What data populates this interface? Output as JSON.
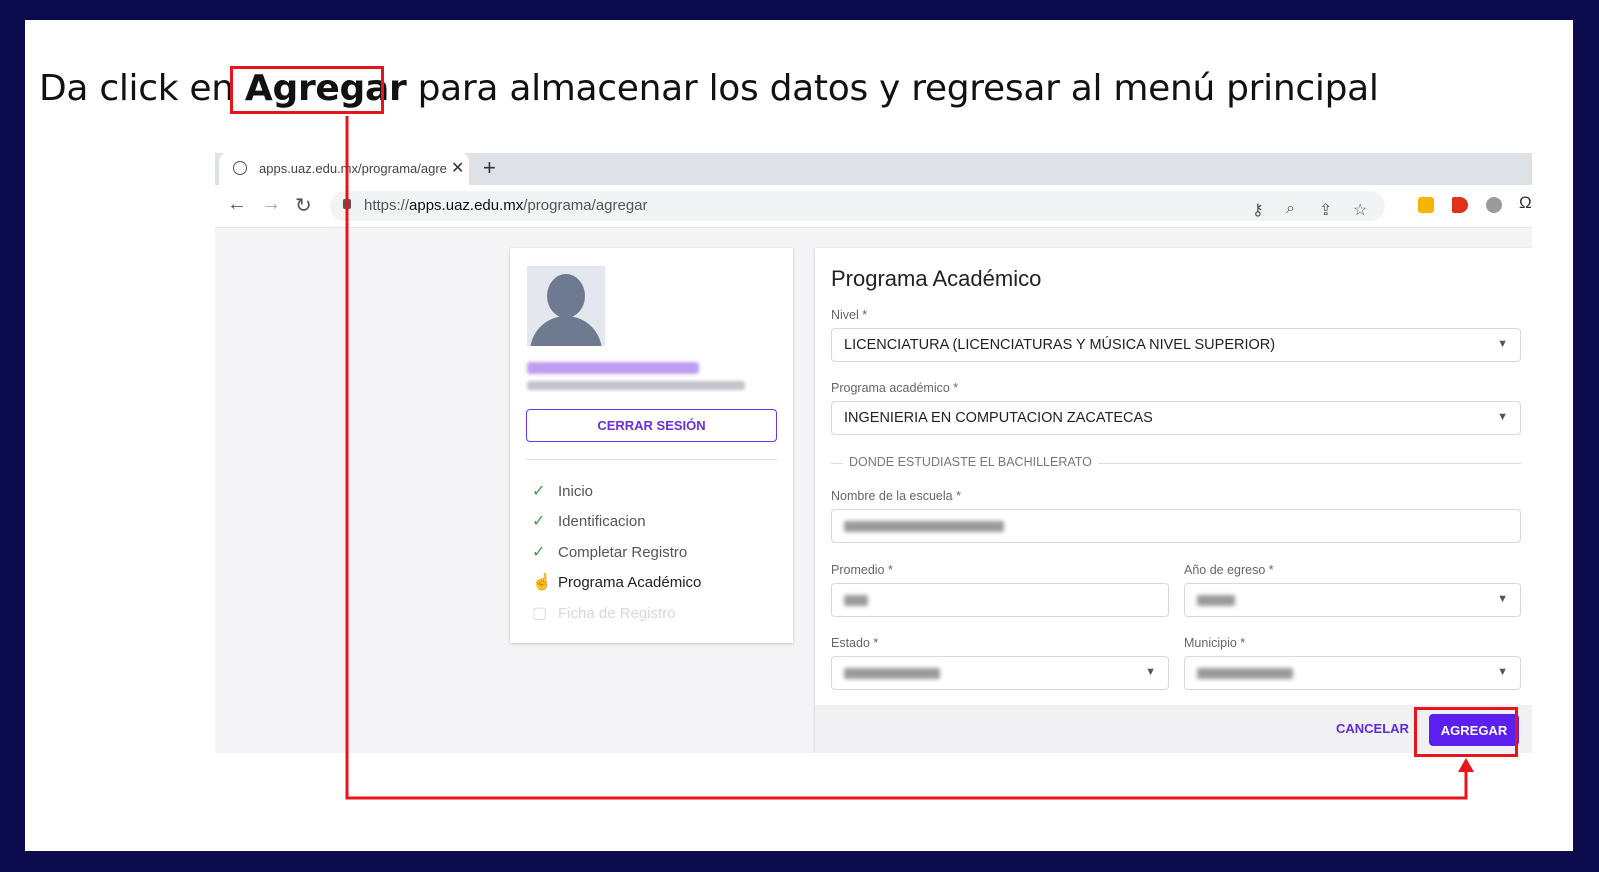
{
  "slide": {
    "pre": "Da click en ",
    "bold": "Agregar",
    "post": "  para almacenar los datos y regresar al menú principal"
  },
  "browser": {
    "tab_title": "apps.uaz.edu.mx/programa/agre",
    "tab_close": "✕",
    "new_tab": "+",
    "url_prefix": "https://",
    "url_host": "apps.uaz.edu.mx",
    "url_path": "/programa/agregar"
  },
  "sidebar": {
    "logout_label": "CERRAR SESIÓN",
    "steps": [
      {
        "label": "Inicio",
        "icon": "✓"
      },
      {
        "label": "Identificacion",
        "icon": "✓"
      },
      {
        "label": "Completar Registro",
        "icon": "✓"
      },
      {
        "label": "Programa Académico",
        "icon": "☝"
      },
      {
        "label": "Ficha de Registro",
        "icon": "▢"
      }
    ]
  },
  "form": {
    "title": "Programa Académico",
    "nivel_label": "Nivel *",
    "nivel_value": "LICENCIATURA (LICENCIATURAS Y MÚSICA NIVEL SUPERIOR)",
    "programa_label": "Programa académico *",
    "programa_value": "INGENIERIA EN COMPUTACION ZACATECAS",
    "section_label": "DONDE ESTUDIASTE EL BACHILLERATO",
    "escuela_label": "Nombre de la escuela *",
    "promedio_label": "Promedio *",
    "anio_label": "Año de egreso *",
    "estado_label": "Estado *",
    "municipio_label": "Municipio *",
    "caret": "▼",
    "cancel_label": "CANCELAR",
    "submit_label": "AGREGAR"
  },
  "colors": {
    "slide_border": "#0b0b4e",
    "highlight": "#e8141b",
    "primary": "#5b1ff0"
  }
}
